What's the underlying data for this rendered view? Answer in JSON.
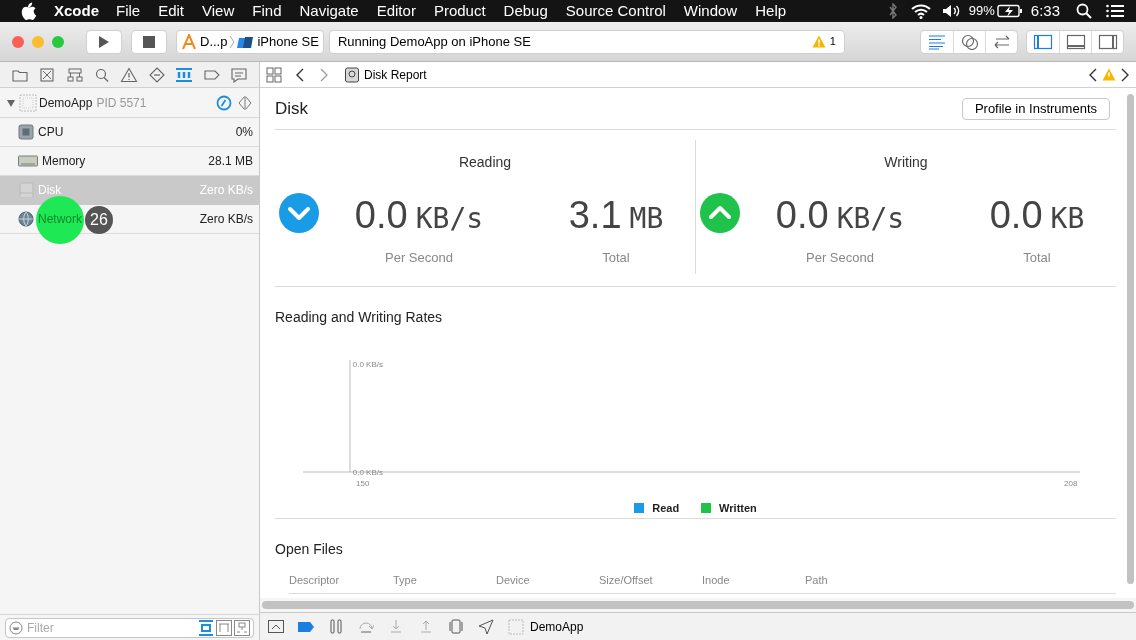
{
  "menu_bar": {
    "app": "Xcode",
    "items": [
      "File",
      "Edit",
      "View",
      "Find",
      "Navigate",
      "Editor",
      "Product",
      "Debug",
      "Source Control",
      "Window",
      "Help"
    ],
    "battery": "99%",
    "time": "6:33"
  },
  "toolbar": {
    "scheme": "D...p",
    "device": "iPhone SE",
    "status": "Running DemoApp on iPhone SE",
    "warning_count": "1",
    "editor_modes": [
      {
        "kind": "standard",
        "selected": true
      },
      {
        "kind": "assistant",
        "selected": false
      },
      {
        "kind": "version",
        "selected": false
      }
    ],
    "panels": [
      {
        "kind": "navigator",
        "selected": true
      },
      {
        "kind": "debug",
        "selected": false
      },
      {
        "kind": "utilities",
        "selected": false
      }
    ]
  },
  "navigator": {
    "tabs": [
      {
        "kind": "folder",
        "selected": false
      },
      {
        "kind": "source",
        "selected": false
      },
      {
        "kind": "symbol",
        "selected": false
      },
      {
        "kind": "find",
        "selected": false
      },
      {
        "kind": "issue",
        "selected": false
      },
      {
        "kind": "test",
        "selected": false
      },
      {
        "kind": "debug",
        "selected": true
      },
      {
        "kind": "breakpoint",
        "selected": false
      },
      {
        "kind": "report",
        "selected": false
      }
    ],
    "process": {
      "name": "DemoApp",
      "pid": "PID 5571",
      "expanded": true
    },
    "gauges": [
      {
        "kind": "cpu",
        "name": "CPU",
        "value": "0%",
        "selected": false
      },
      {
        "kind": "memory",
        "name": "Memory",
        "value": "28.1 MB",
        "selected": false
      },
      {
        "kind": "disk",
        "name": "Disk",
        "value": "Zero KB/s",
        "selected": true
      },
      {
        "kind": "network",
        "name": "Network",
        "value": "Zero KB/s",
        "selected": false
      }
    ],
    "filter": {
      "placeholder": "Filter"
    }
  },
  "jump_bar": {
    "title": "Disk Report"
  },
  "report": {
    "title": "Disk",
    "button": "Profile in Instruments",
    "panels": [
      {
        "heading": "Reading",
        "kind": "reading",
        "rate": "0.0",
        "rate_unit": "KB/s",
        "rate_caption": "Per Second",
        "total": "3.1",
        "total_unit": "MB",
        "total_caption": "Total"
      },
      {
        "heading": "Writing",
        "kind": "writing",
        "rate": "0.0",
        "rate_unit": "KB/s",
        "rate_caption": "Per Second",
        "total": "0.0",
        "total_unit": "KB",
        "total_caption": "Total"
      }
    ]
  },
  "rates": {
    "title": "Reading and Writing Rates",
    "y_axis_labels": [
      "0.0 KB/s",
      "0.0 KB/s"
    ],
    "x_axis_labels": [
      "150",
      "208"
    ],
    "legend": [
      {
        "name": "Read",
        "color": "#1a9be6"
      },
      {
        "name": "Written",
        "color": "#1fc24a"
      }
    ]
  },
  "open_files": {
    "title": "Open Files",
    "columns": [
      "Descriptor",
      "Type",
      "Device",
      "Size/Offset",
      "Inode",
      "Path"
    ]
  },
  "debug_bar": {
    "process": "DemoApp"
  },
  "tap_marker": {
    "label": "26"
  }
}
